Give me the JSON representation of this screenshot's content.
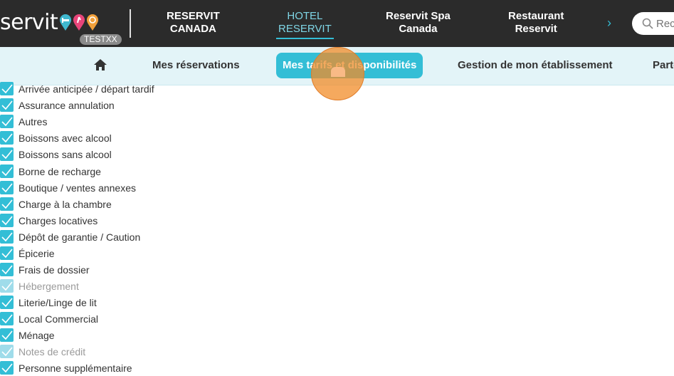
{
  "header": {
    "logo_text": "servit",
    "badge": "TESTXX",
    "brands": [
      {
        "line1": "RESERVIT",
        "line2": "CANADA"
      },
      {
        "line1": "HOTEL",
        "line2": "RESERVIT"
      },
      {
        "line1": "Reservit Spa",
        "line2": "Canada"
      },
      {
        "line1": "Restaurant",
        "line2": "Reservit"
      }
    ],
    "search_placeholder": "Rec",
    "chevron": "›",
    "pin_colors": [
      "#3fb8cf",
      "#e8457a",
      "#f2a03a"
    ],
    "accent": "#33bed6"
  },
  "nav": {
    "items": [
      "Mes réservations",
      "Mes tarifs et disponibilités",
      "Gestion de mon établissement",
      "Parte"
    ]
  },
  "list": {
    "items": [
      {
        "label": "Arrivée anticipée / départ tardif",
        "checked": true,
        "disabled": false
      },
      {
        "label": "Assurance annulation",
        "checked": true,
        "disabled": false
      },
      {
        "label": "Autres",
        "checked": true,
        "disabled": false
      },
      {
        "label": "Boissons avec alcool",
        "checked": true,
        "disabled": false
      },
      {
        "label": "Boissons sans alcool",
        "checked": true,
        "disabled": false
      },
      {
        "label": "Borne de recharge",
        "checked": true,
        "disabled": false
      },
      {
        "label": "Boutique / ventes annexes",
        "checked": true,
        "disabled": false
      },
      {
        "label": "Charge à la chambre",
        "checked": true,
        "disabled": false
      },
      {
        "label": "Charges locatives",
        "checked": true,
        "disabled": false
      },
      {
        "label": "Dépôt de garantie / Caution",
        "checked": true,
        "disabled": false
      },
      {
        "label": "Épicerie",
        "checked": true,
        "disabled": false
      },
      {
        "label": "Frais de dossier",
        "checked": true,
        "disabled": false
      },
      {
        "label": "Hébergement",
        "checked": true,
        "disabled": true
      },
      {
        "label": "Literie/Linge de lit",
        "checked": true,
        "disabled": false
      },
      {
        "label": "Local Commercial",
        "checked": true,
        "disabled": false
      },
      {
        "label": "Ménage",
        "checked": true,
        "disabled": false
      },
      {
        "label": "Notes de crédit",
        "checked": true,
        "disabled": true
      },
      {
        "label": "Personne supplémentaire",
        "checked": true,
        "disabled": false
      }
    ]
  }
}
